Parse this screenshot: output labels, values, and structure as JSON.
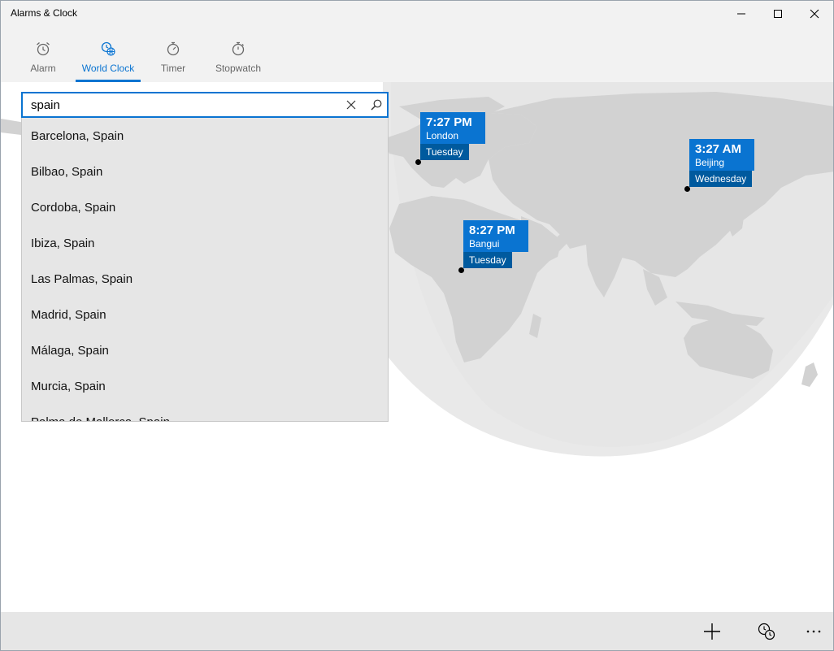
{
  "window": {
    "title": "Alarms & Clock"
  },
  "tabs": [
    {
      "label": "Alarm",
      "icon": "alarm-clock-icon",
      "active": false
    },
    {
      "label": "World Clock",
      "icon": "world-clock-icon",
      "active": true
    },
    {
      "label": "Timer",
      "icon": "timer-icon",
      "active": false
    },
    {
      "label": "Stopwatch",
      "icon": "stopwatch-icon",
      "active": false
    }
  ],
  "search": {
    "value": "spain",
    "suggestions": [
      "Barcelona, Spain",
      "Bilbao, Spain",
      "Cordoba, Spain",
      "Ibiza, Spain",
      "Las Palmas, Spain",
      "Madrid, Spain",
      "Málaga, Spain",
      "Murcia, Spain",
      "Palma de Mallorca, Spain"
    ]
  },
  "cities": [
    {
      "time": "7:27 PM",
      "name": "London",
      "day": "Tuesday"
    },
    {
      "time": "8:27 PM",
      "name": "Bangui",
      "day": "Tuesday"
    },
    {
      "time": "3:27 AM",
      "name": "Beijing",
      "day": "Wednesday"
    }
  ],
  "colors": {
    "accent": "#0a74d1",
    "accent_dark": "#005a9e",
    "land": "#d2d2d2",
    "night": "#e8e8e8"
  },
  "appbar": {
    "buttons": [
      "add-icon",
      "compare-clock-icon",
      "more-icon"
    ]
  }
}
